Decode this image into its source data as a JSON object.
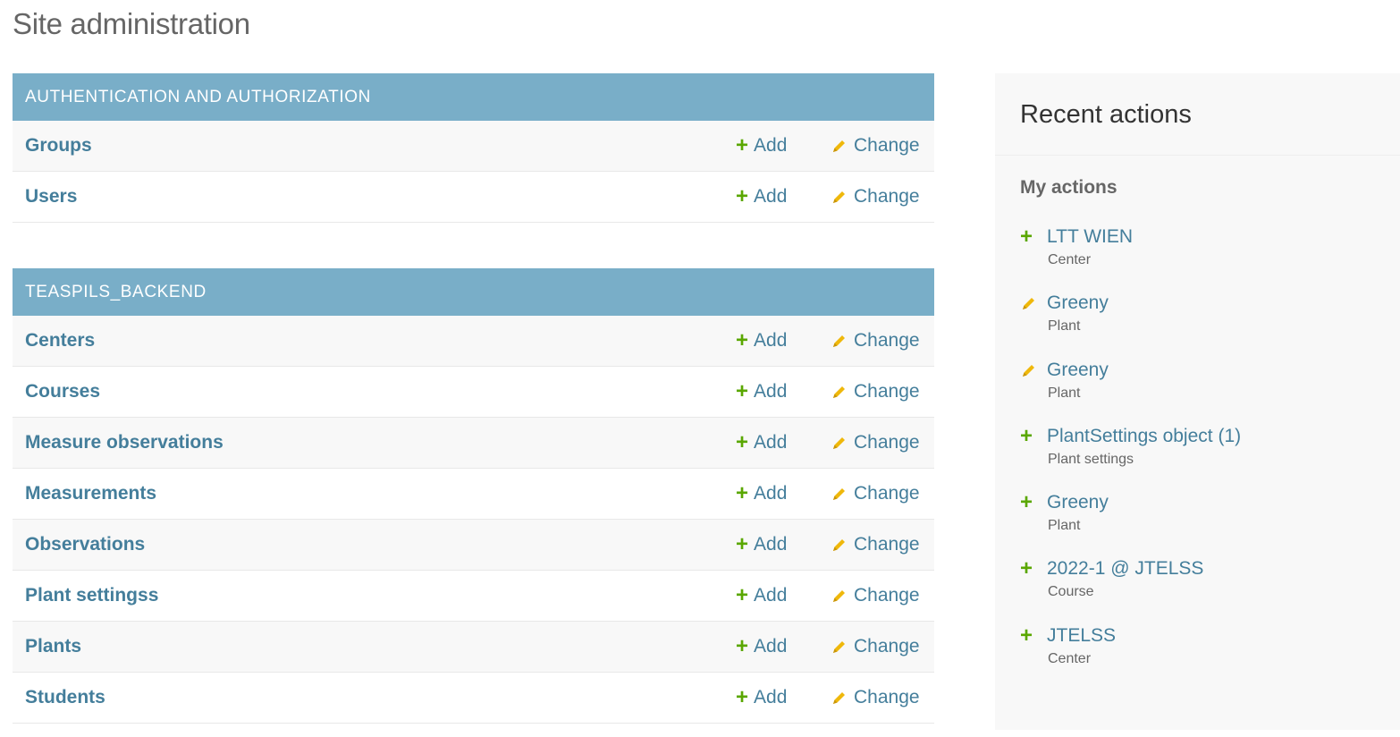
{
  "page": {
    "title": "Site administration"
  },
  "modules": [
    {
      "header": "Authentication and Authorization",
      "models": [
        {
          "name": "Groups",
          "add": "Add",
          "change": "Change"
        },
        {
          "name": "Users",
          "add": "Add",
          "change": "Change"
        }
      ]
    },
    {
      "header": "Teaspils_Backend",
      "models": [
        {
          "name": "Centers",
          "add": "Add",
          "change": "Change"
        },
        {
          "name": "Courses",
          "add": "Add",
          "change": "Change"
        },
        {
          "name": "Measure observations",
          "add": "Add",
          "change": "Change"
        },
        {
          "name": "Measurements",
          "add": "Add",
          "change": "Change"
        },
        {
          "name": "Observations",
          "add": "Add",
          "change": "Change"
        },
        {
          "name": "Plant settingss",
          "add": "Add",
          "change": "Change"
        },
        {
          "name": "Plants",
          "add": "Add",
          "change": "Change"
        },
        {
          "name": "Students",
          "add": "Add",
          "change": "Change"
        }
      ]
    }
  ],
  "sidebar": {
    "title": "Recent actions",
    "subtitle": "My actions",
    "items": [
      {
        "icon": "plus-icon",
        "label": "LTT WIEN",
        "type": "Center"
      },
      {
        "icon": "pencil-icon",
        "label": "Greeny",
        "type": "Plant"
      },
      {
        "icon": "pencil-icon",
        "label": "Greeny",
        "type": "Plant"
      },
      {
        "icon": "plus-icon",
        "label": "PlantSettings object (1)",
        "type": "Plant settings"
      },
      {
        "icon": "plus-icon",
        "label": "Greeny",
        "type": "Plant"
      },
      {
        "icon": "plus-icon",
        "label": "2022-1 @ JTELSS",
        "type": "Course"
      },
      {
        "icon": "plus-icon",
        "label": "JTELSS",
        "type": "Center"
      }
    ]
  },
  "colors": {
    "header_bg": "#79aec8",
    "link": "#447e9b",
    "add_green": "#5aa700",
    "change_yellow": "#efb80b"
  }
}
